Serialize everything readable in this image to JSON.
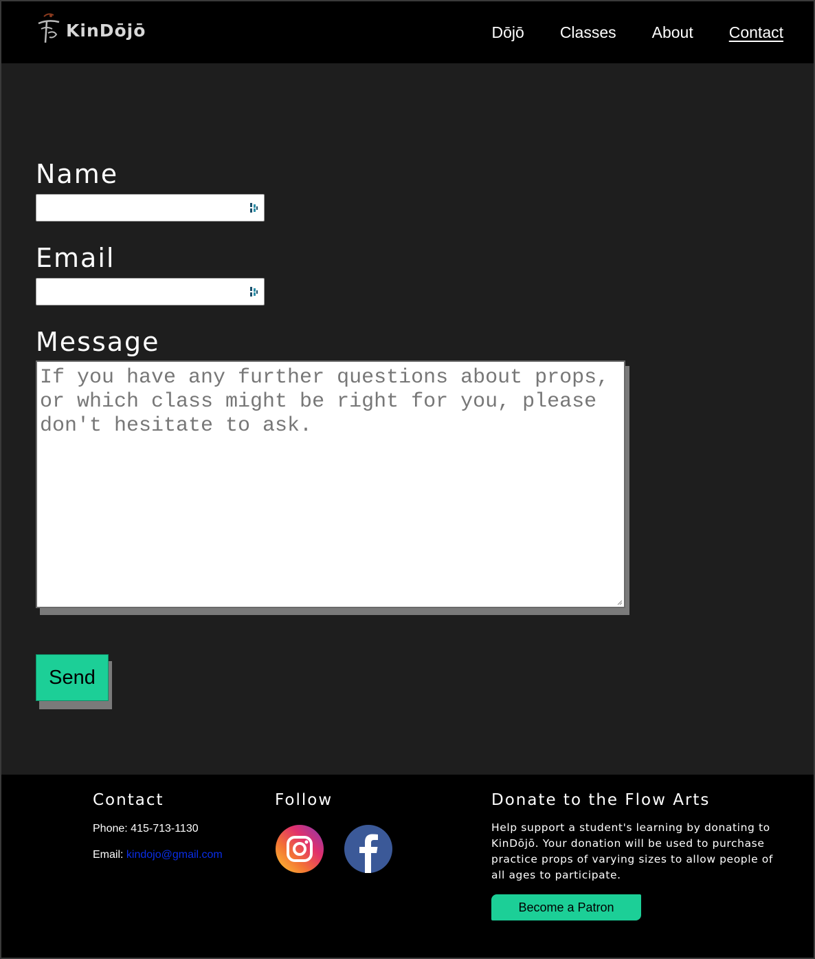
{
  "header": {
    "logo_text": "KinDōjō",
    "nav": [
      {
        "label": "Dōjō"
      },
      {
        "label": "Classes"
      },
      {
        "label": "About"
      },
      {
        "label": "Contact"
      }
    ]
  },
  "form": {
    "name_label": "Name",
    "name_value": "",
    "email_label": "Email",
    "email_value": "",
    "message_label": "Message",
    "message_placeholder": "If you have any further questions about props, or which class might be right for you, please don't hesitate to ask.",
    "send_label": "Send"
  },
  "footer": {
    "contact_heading": "Contact",
    "phone_label": "Phone:",
    "phone_value": "415-713-1130",
    "email_label": "Email:",
    "email_value": "kindojo@gmail.com",
    "follow_heading": "Follow",
    "social_icons": [
      "instagram-icon",
      "facebook-icon"
    ],
    "donate_heading": "Donate to the Flow Arts",
    "donate_text": "Help support a student's learning by donating to KinDōjō. Your donation will be used to purchase practice props of varying sizes to allow people of all ages to participate.",
    "patron_button": "Become a Patron"
  },
  "colors": {
    "accent": "#1ccf97",
    "background": "#1e1e1e",
    "header_footer": "#000000",
    "link": "#0a2ee8"
  }
}
